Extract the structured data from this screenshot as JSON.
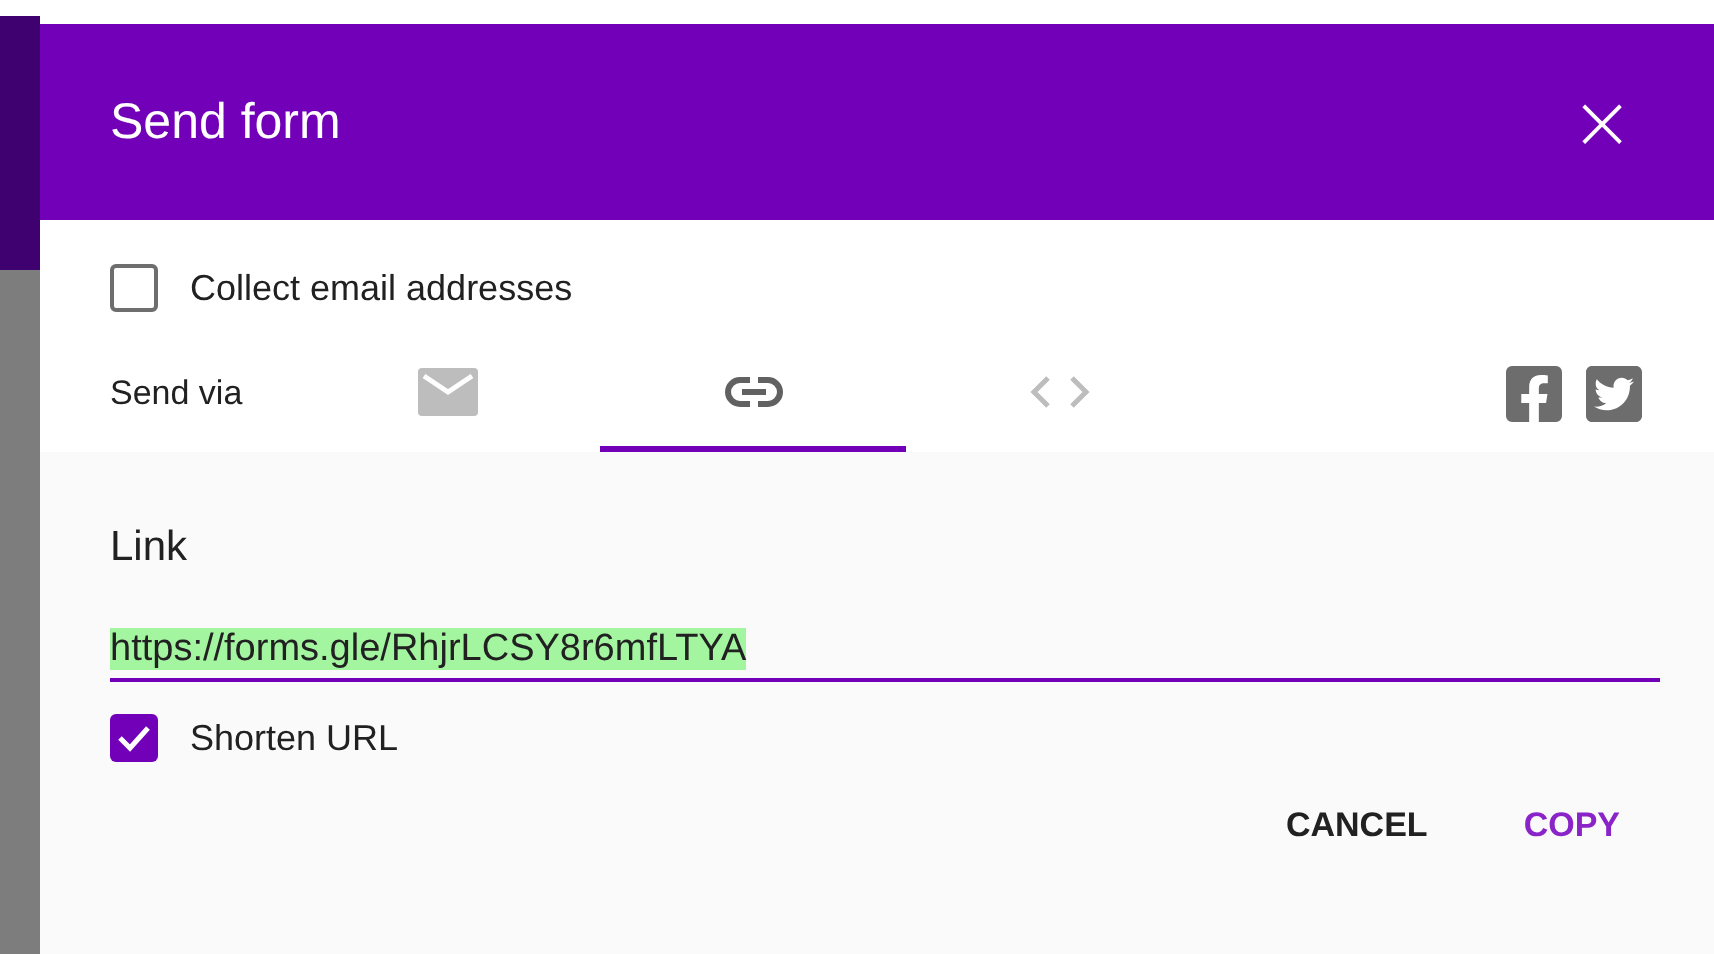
{
  "dialog": {
    "title": "Send form",
    "close": "×"
  },
  "collect_email": {
    "label": "Collect email addresses",
    "checked": false
  },
  "send_via": {
    "label": "Send via",
    "tabs": [
      {
        "kind": "email",
        "selected": false
      },
      {
        "kind": "link",
        "selected": true
      },
      {
        "kind": "embed",
        "selected": false
      }
    ],
    "share": [
      {
        "kind": "facebook"
      },
      {
        "kind": "twitter"
      }
    ]
  },
  "link": {
    "heading": "Link",
    "url": "https://forms.gle/RhjrLCSY8r6mfLTYA",
    "shorten": {
      "label": "Shorten URL",
      "checked": true
    }
  },
  "buttons": [
    {
      "label": "CANCEL",
      "kind": "default"
    },
    {
      "label": "COPY",
      "kind": "primary"
    }
  ]
}
